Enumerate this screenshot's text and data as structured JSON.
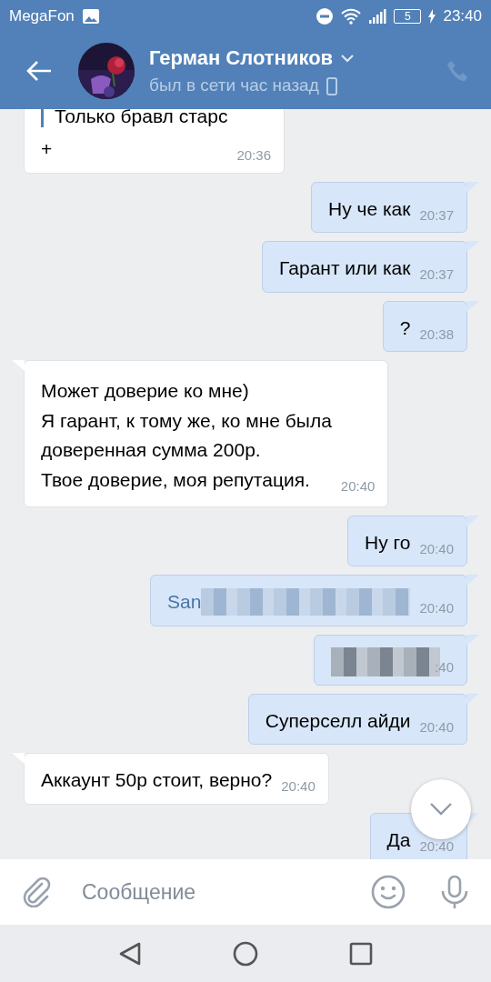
{
  "status_bar": {
    "carrier": "MegaFon",
    "battery": "5",
    "time": "23:40"
  },
  "header": {
    "name": "Герман Слотников",
    "status": "был в сети час назад"
  },
  "messages": [
    {
      "kind": "incoming",
      "quote": "Только бравл старс",
      "text": "+",
      "time": "20:36"
    },
    {
      "kind": "outgoing",
      "text": "Ну че как",
      "time": "20:37"
    },
    {
      "kind": "outgoing",
      "text": "Гарант или как",
      "time": "20:37"
    },
    {
      "kind": "outgoing",
      "text": "?",
      "time": "20:38"
    },
    {
      "kind": "incoming",
      "text": "Может доверие ко мне)\nЯ гарант, к тому же, ко мне была\nдоверенная сумма 200р.\nТвое доверие, моя репутация.",
      "time": "20:40"
    },
    {
      "kind": "outgoing",
      "text": "Ну го",
      "time": "20:40"
    },
    {
      "kind": "outgoing",
      "text": "San",
      "link": true,
      "redacted": true,
      "time": "20:40"
    },
    {
      "kind": "outgoing",
      "redacted": true,
      "time": ":40"
    },
    {
      "kind": "outgoing",
      "text": "Суперселл айди",
      "time": "20:40"
    },
    {
      "kind": "incoming",
      "text": "Аккаунт 50р стоит, верно?",
      "time": "20:40"
    },
    {
      "kind": "outgoing",
      "text": "Да",
      "time": "20:40"
    }
  ],
  "composer": {
    "placeholder": "Сообщение"
  }
}
